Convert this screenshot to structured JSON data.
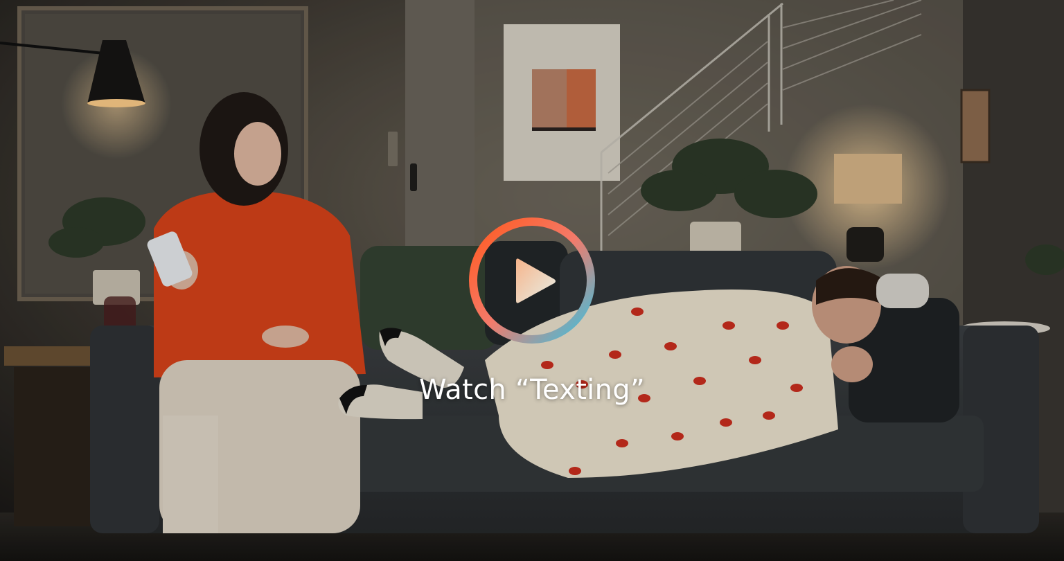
{
  "video": {
    "title": "Watch “Texting”",
    "poster_description_icon": "play-icon"
  },
  "colors": {
    "play_ring_start": "#ff5a1f",
    "play_ring_mid": "#f47a6a",
    "play_ring_end": "#35c3e3",
    "play_triangle_start": "#f6b48b",
    "play_triangle_end": "#e7efe6",
    "title_text": "#ffffff"
  }
}
